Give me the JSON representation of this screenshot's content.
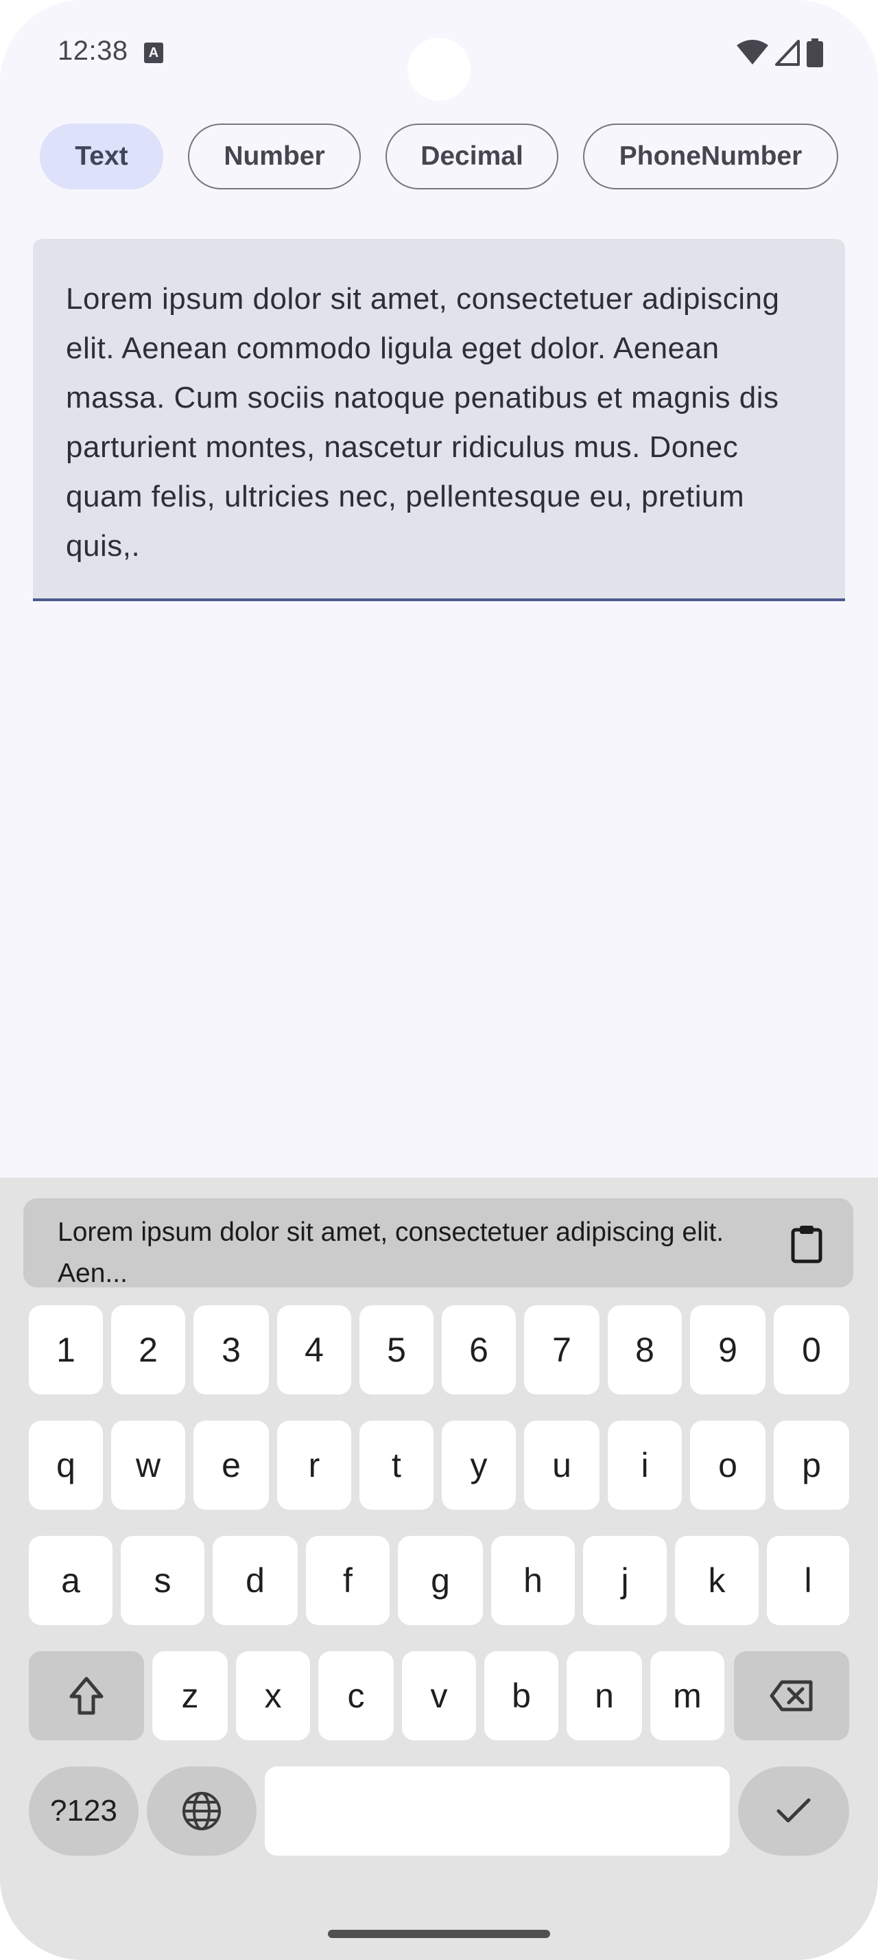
{
  "status_bar": {
    "time": "12:38",
    "notification_icon": "A",
    "icons": [
      "wifi-icon",
      "cell-signal-icon",
      "battery-icon"
    ]
  },
  "input_type_chips": [
    {
      "label": "Text",
      "selected": true
    },
    {
      "label": "Number",
      "selected": false
    },
    {
      "label": "Decimal",
      "selected": false
    },
    {
      "label": "PhoneNumber",
      "selected": false
    }
  ],
  "text_field": {
    "value": "Lorem ipsum dolor sit amet, consectetuer adipiscing elit. Aenean commodo ligula eget dolor. Aenean massa. Cum sociis natoque penatibus et magnis dis parturient montes, nascetur ridiculus mus. Donec quam felis, ultricies nec, pellentesque eu, pretium quis,."
  },
  "keyboard": {
    "clipboard_suggestion": "Lorem ipsum dolor sit amet, consectetuer adipiscing elit. Aen...",
    "number_row": [
      "1",
      "2",
      "3",
      "4",
      "5",
      "6",
      "7",
      "8",
      "9",
      "0"
    ],
    "row1": [
      "q",
      "w",
      "e",
      "r",
      "t",
      "y",
      "u",
      "i",
      "o",
      "p"
    ],
    "row2": [
      "a",
      "s",
      "d",
      "f",
      "g",
      "h",
      "j",
      "k",
      "l"
    ],
    "row3": [
      "z",
      "x",
      "c",
      "v",
      "b",
      "n",
      "m"
    ],
    "symbols_label": "?123",
    "space_label": ""
  },
  "colors": {
    "background": "#f7f6fd",
    "chip_selected": "#dde1f9",
    "field_background": "#e1e2ea",
    "field_indicator": "#4a5a8e",
    "keyboard_background": "#e3e3e3"
  }
}
